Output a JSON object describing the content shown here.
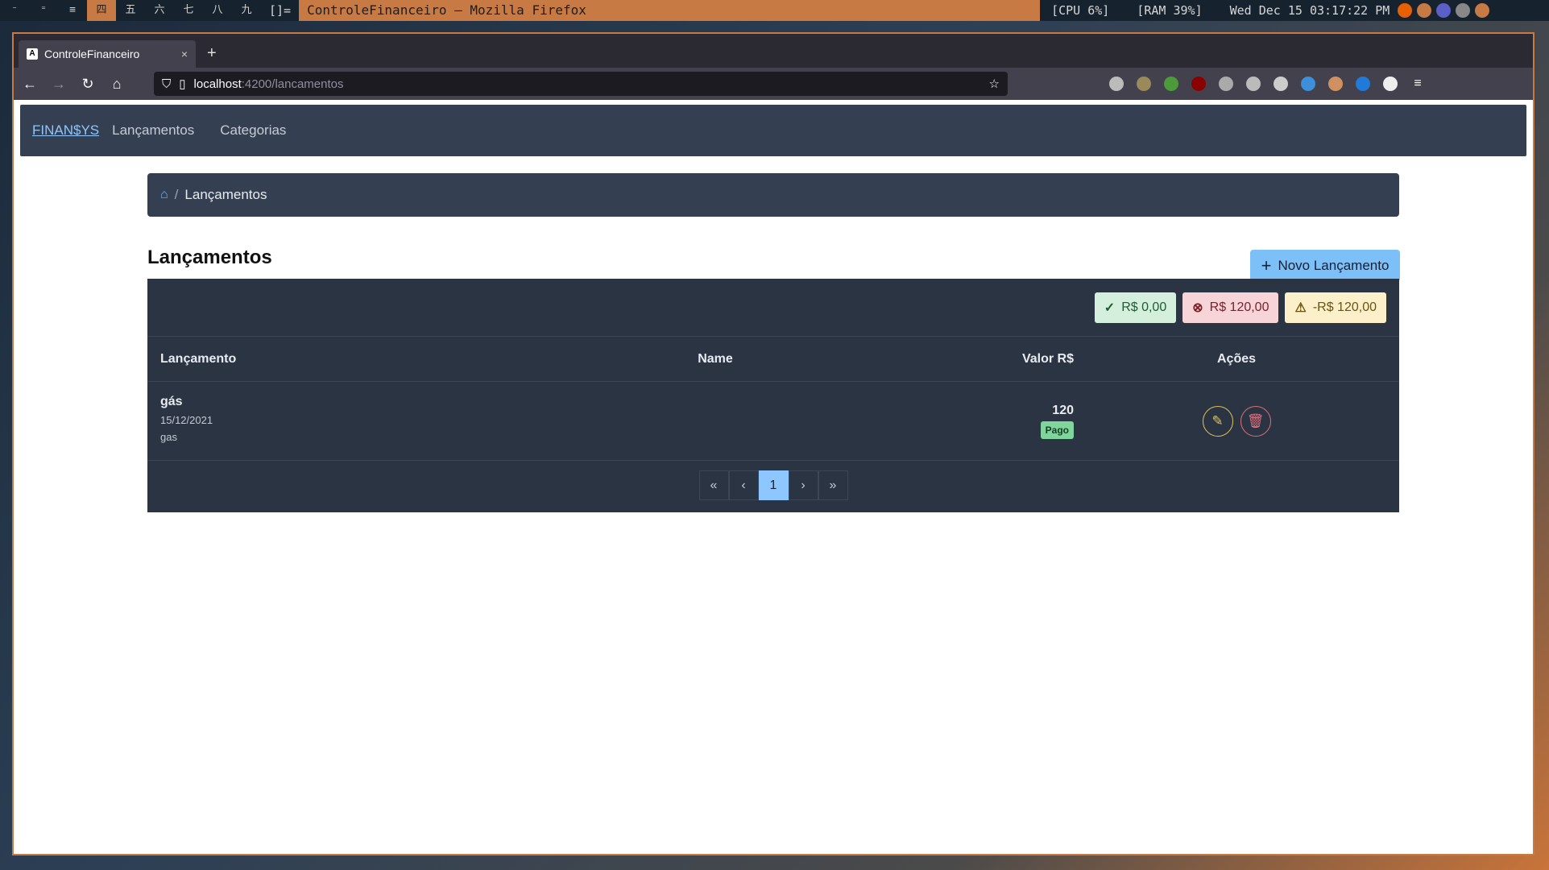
{
  "system_bar": {
    "layout_icons": [
      "⁻",
      "⁼",
      "≡"
    ],
    "workspaces": [
      "四",
      "五",
      "六",
      "七",
      "八",
      "九"
    ],
    "layout_symbol": "[]=",
    "window_title": "ControleFinanceiro — Mozilla Firefox",
    "cpu": "[CPU  6%]",
    "ram": "[RAM  39%]",
    "clock": "Wed Dec 15 03:17:22 PM"
  },
  "browser": {
    "tab_title": "ControleFinanceiro",
    "tab_favicon": "A",
    "tab_close": "×",
    "new_tab": "+",
    "url_host": "localhost",
    "url_path": ":4200/lancamentos",
    "icons": {
      "back": "back-icon",
      "forward": "forward-icon",
      "reload": "reload-icon",
      "home": "home-icon",
      "bookmark": "star-icon",
      "menu": "hamburger-menu-icon"
    }
  },
  "app_nav": {
    "brand": "FINAN$YS",
    "links": [
      "Lançamentos",
      "Categorias"
    ]
  },
  "breadcrumb": {
    "current": "Lançamentos"
  },
  "page": {
    "title": "Lançamentos",
    "new_button": "Novo Lançamento"
  },
  "summary": {
    "paid": "R$ 0,00",
    "pending": "R$ 120,00",
    "balance": "-R$ 120,00"
  },
  "table": {
    "headers": [
      "Lançamento",
      "Name",
      "Valor R$",
      "Ações"
    ],
    "rows": [
      {
        "title": "gás",
        "date": "15/12/2021",
        "category": "gas",
        "name": "",
        "value": "120",
        "status": "Pago"
      }
    ]
  },
  "pagination": {
    "first": "«",
    "prev": "‹",
    "current": "1",
    "next": "›",
    "last": "»"
  },
  "colors": {
    "navbar": "#343f51",
    "card": "#2a3442",
    "accent": "#8ec6ff",
    "window_border": "#c87a45"
  }
}
